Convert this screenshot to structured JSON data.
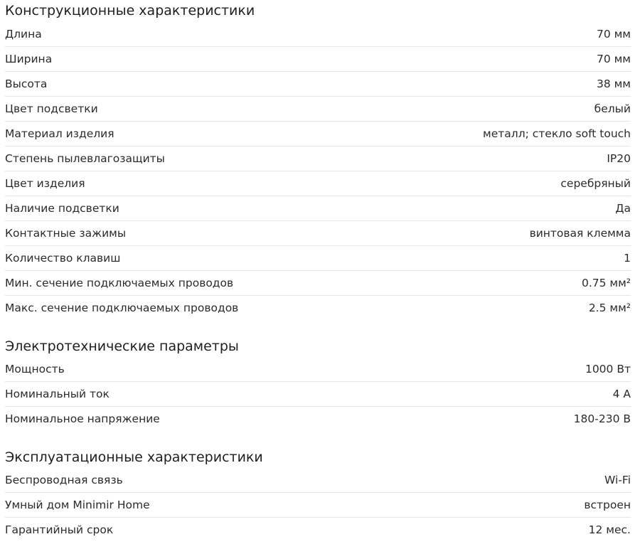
{
  "sections": [
    {
      "title": "Конструкционные характеристики",
      "rows": [
        {
          "label": "Длина",
          "value": "70 мм"
        },
        {
          "label": "Ширина",
          "value": "70 мм"
        },
        {
          "label": "Высота",
          "value": "38 мм"
        },
        {
          "label": "Цвет подсветки",
          "value": "белый"
        },
        {
          "label": "Материал изделия",
          "value": "металл; стекло soft touch"
        },
        {
          "label": "Степень пылевлагозащиты",
          "value": "IP20"
        },
        {
          "label": "Цвет изделия",
          "value": "серебряный"
        },
        {
          "label": "Наличие подсветки",
          "value": "Да"
        },
        {
          "label": "Контактные зажимы",
          "value": "винтовая клемма"
        },
        {
          "label": "Количество клавиш",
          "value": "1"
        },
        {
          "label": "Мин. сечение подключаемых проводов",
          "value": "0.75 мм²"
        },
        {
          "label": "Макс. сечение подключаемых проводов",
          "value": "2.5 мм²"
        }
      ]
    },
    {
      "title": "Электротехнические параметры",
      "rows": [
        {
          "label": "Мощность",
          "value": "1000 Вт"
        },
        {
          "label": "Номинальный ток",
          "value": "4 А"
        },
        {
          "label": "Номинальное напряжение",
          "value": "180-230 В"
        }
      ]
    },
    {
      "title": "Эксплуатационные характеристики",
      "rows": [
        {
          "label": "Беспроводная связь",
          "value": "Wi-Fi"
        },
        {
          "label": "Умный дом Minimir Home",
          "value": "встроен"
        },
        {
          "label": "Гарантийный срок",
          "value": "12 мес."
        }
      ]
    }
  ]
}
